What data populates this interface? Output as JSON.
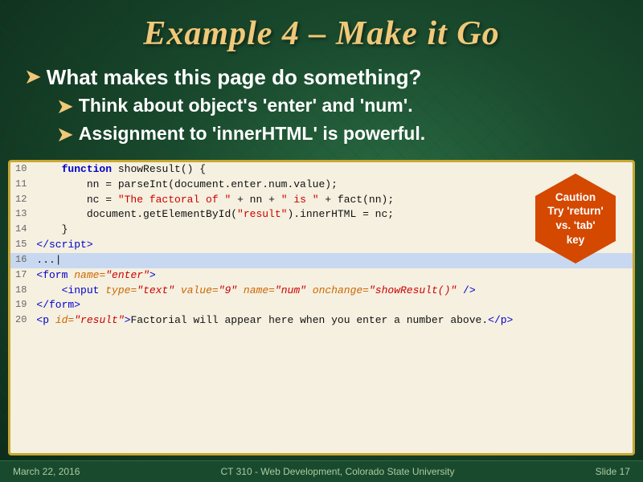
{
  "slide": {
    "title": "Example 4 – Make it Go",
    "bullets": [
      {
        "text": "What makes this page do something?",
        "level": 1
      },
      {
        "text": "Think about object's 'enter' and 'num'.",
        "level": 2
      },
      {
        "text": "Assignment to 'innerHTML' is powerful.",
        "level": 2
      }
    ],
    "caution": {
      "line1": "Caution",
      "line2": "Try 'return'",
      "line3": "vs. 'tab'",
      "line4": "key"
    },
    "code_lines": [
      {
        "num": "10",
        "highlight": false
      },
      {
        "num": "11",
        "highlight": false
      },
      {
        "num": "12",
        "highlight": false
      },
      {
        "num": "13",
        "highlight": false
      },
      {
        "num": "14",
        "highlight": false
      },
      {
        "num": "15",
        "highlight": false
      },
      {
        "num": "16",
        "highlight": true
      },
      {
        "num": "17",
        "highlight": false
      },
      {
        "num": "18",
        "highlight": false
      },
      {
        "num": "19",
        "highlight": false
      },
      {
        "num": "20",
        "highlight": false
      }
    ],
    "footer": {
      "date": "March 22, 2016",
      "course": "CT 310 - Web Development, Colorado State University",
      "slide": "Slide 17"
    }
  }
}
